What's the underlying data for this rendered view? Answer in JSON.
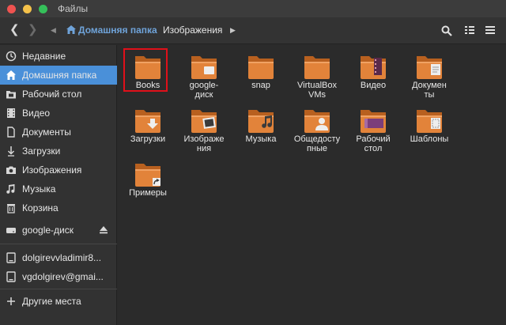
{
  "window": {
    "title": "Файлы"
  },
  "toolbar": {
    "back_icon": "back-arrow-icon",
    "forward_icon": "forward-arrow-icon",
    "breadcrumbs": [
      "Домашняя папка",
      "Изображения"
    ],
    "actions": [
      "search-icon",
      "list-view-icon",
      "menu-icon"
    ]
  },
  "sidebar": {
    "items": [
      {
        "label": "Недавние",
        "icon": "clock-icon"
      },
      {
        "label": "Домашняя папка",
        "icon": "home-icon",
        "active": true
      },
      {
        "label": "Рабочий стол",
        "icon": "desktop-folder-icon"
      },
      {
        "label": "Видео",
        "icon": "video-icon"
      },
      {
        "label": "Документы",
        "icon": "document-icon"
      },
      {
        "label": "Загрузки",
        "icon": "download-icon"
      },
      {
        "label": "Изображения",
        "icon": "camera-icon"
      },
      {
        "label": "Музыка",
        "icon": "music-icon"
      },
      {
        "label": "Корзина",
        "icon": "trash-icon"
      },
      {
        "label": "google-диск",
        "icon": "drive-icon"
      },
      {
        "label": "dolgirevvladimir8...",
        "icon": "account-icon"
      },
      {
        "label": "vgdolgirev@gmai...",
        "icon": "account-icon"
      },
      {
        "label": "Другие места",
        "icon": "plus-icon"
      }
    ]
  },
  "files": [
    {
      "name": "Books"
    },
    {
      "name": "google-\nдиск"
    },
    {
      "name": "snap"
    },
    {
      "name": "VirtualBox\nVMs"
    },
    {
      "name": "Видео"
    },
    {
      "name": "Докумен\nты"
    },
    {
      "name": "Загрузки"
    },
    {
      "name": "Изображе\nния"
    },
    {
      "name": "Музыка"
    },
    {
      "name": "Общедосту\nпные"
    },
    {
      "name": "Рабочий\nстол"
    },
    {
      "name": "Шаблоны"
    },
    {
      "name": "Примеры"
    }
  ],
  "colors": {
    "accent": "#4a90d9",
    "folder": "#e2833a",
    "highlight": "#e0101a"
  }
}
